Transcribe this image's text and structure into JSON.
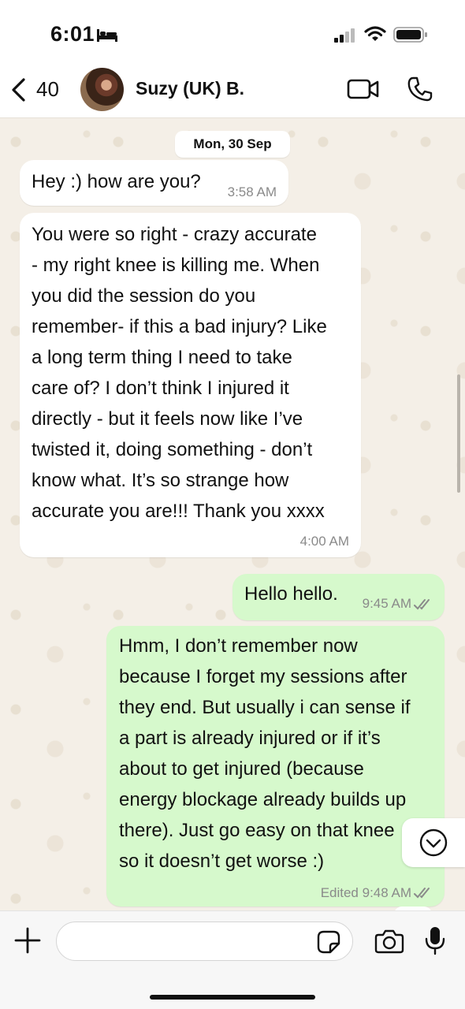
{
  "status_bar": {
    "time": "6:01",
    "icons": [
      "bed-icon",
      "signal-icon",
      "wifi-icon",
      "battery-icon"
    ]
  },
  "header": {
    "back_count": "40",
    "contact_name": "Suzy (UK) B.",
    "icons": [
      "chevron-left-icon",
      "video-call-icon",
      "phone-call-icon"
    ]
  },
  "chat": {
    "date_chip": "Mon, 30 Sep",
    "messages": [
      {
        "direction": "incoming",
        "text": "Hey :) how are you?",
        "time": "3:58 AM"
      },
      {
        "direction": "incoming",
        "text": "You were so right - crazy accurate\n- my right knee is killing me. When\nyou did the session do you\nremember- if this a bad injury? Like\na long term thing I need to take\ncare of? I don’t think I injured it\ndirectly - but it feels now like I’ve\ntwisted it, doing something - don’t\nknow what. It’s so strange how\naccurate you are!!! Thank you xxxx",
        "time": "4:00 AM"
      },
      {
        "direction": "outgoing",
        "text": "Hello hello.",
        "time": "9:45 AM",
        "status": "read"
      },
      {
        "direction": "outgoing",
        "text": "Hmm, I don’t remember now\nbecause I forget my sessions after\nthey end. But usually i can sense if\na part is already injured or if it’s\nabout to get injured (because\nenergy blockage already builds up\nthere). Just go easy on that knee\nso it doesn’t get worse :)",
        "time": "Edited 9:48 AM",
        "status": "read"
      }
    ]
  },
  "input": {
    "value": "",
    "placeholder": ""
  },
  "colors": {
    "incoming_bubble": "#ffffff",
    "outgoing_bubble": "#d6f9cc",
    "chat_background": "#f4efe7",
    "read_ticks": "#8a8a8a"
  }
}
